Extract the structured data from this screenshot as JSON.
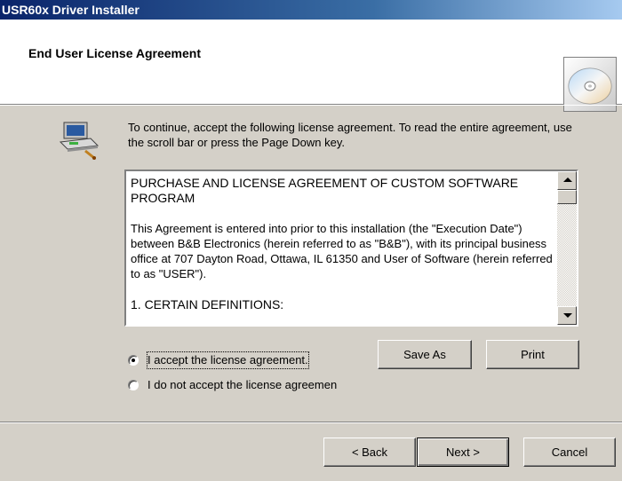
{
  "window": {
    "title": "USR60x Driver Installer"
  },
  "header": {
    "title": "End User License Agreement"
  },
  "intro": "To continue, accept the following license agreement. To read the entire agreement, use the scroll bar or press the Page Down key.",
  "license": {
    "heading": "PURCHASE AND LICENSE AGREEMENT OF CUSTOM SOFTWARE PROGRAM",
    "body": "This Agreement is entered into prior to this installation (the \"Execution Date\") between B&B Electronics (herein referred to as \"B&B\"), with its principal business office at 707 Dayton Road, Ottawa, IL 61350 and User of Software (herein referred to as \"USER\").",
    "section1": "1. CERTAIN DEFINITIONS:"
  },
  "options": {
    "accept": {
      "label": "I accept the license agreement.",
      "selected": true
    },
    "decline": {
      "label": "I do not accept the license agreemen",
      "selected": false
    }
  },
  "buttons": {
    "save_as": "Save As",
    "print": "Print",
    "back": "< Back",
    "next": "Next >",
    "cancel": "Cancel"
  },
  "icons": {
    "header": "cd-disc-icon",
    "intro": "computer-setup-icon"
  }
}
